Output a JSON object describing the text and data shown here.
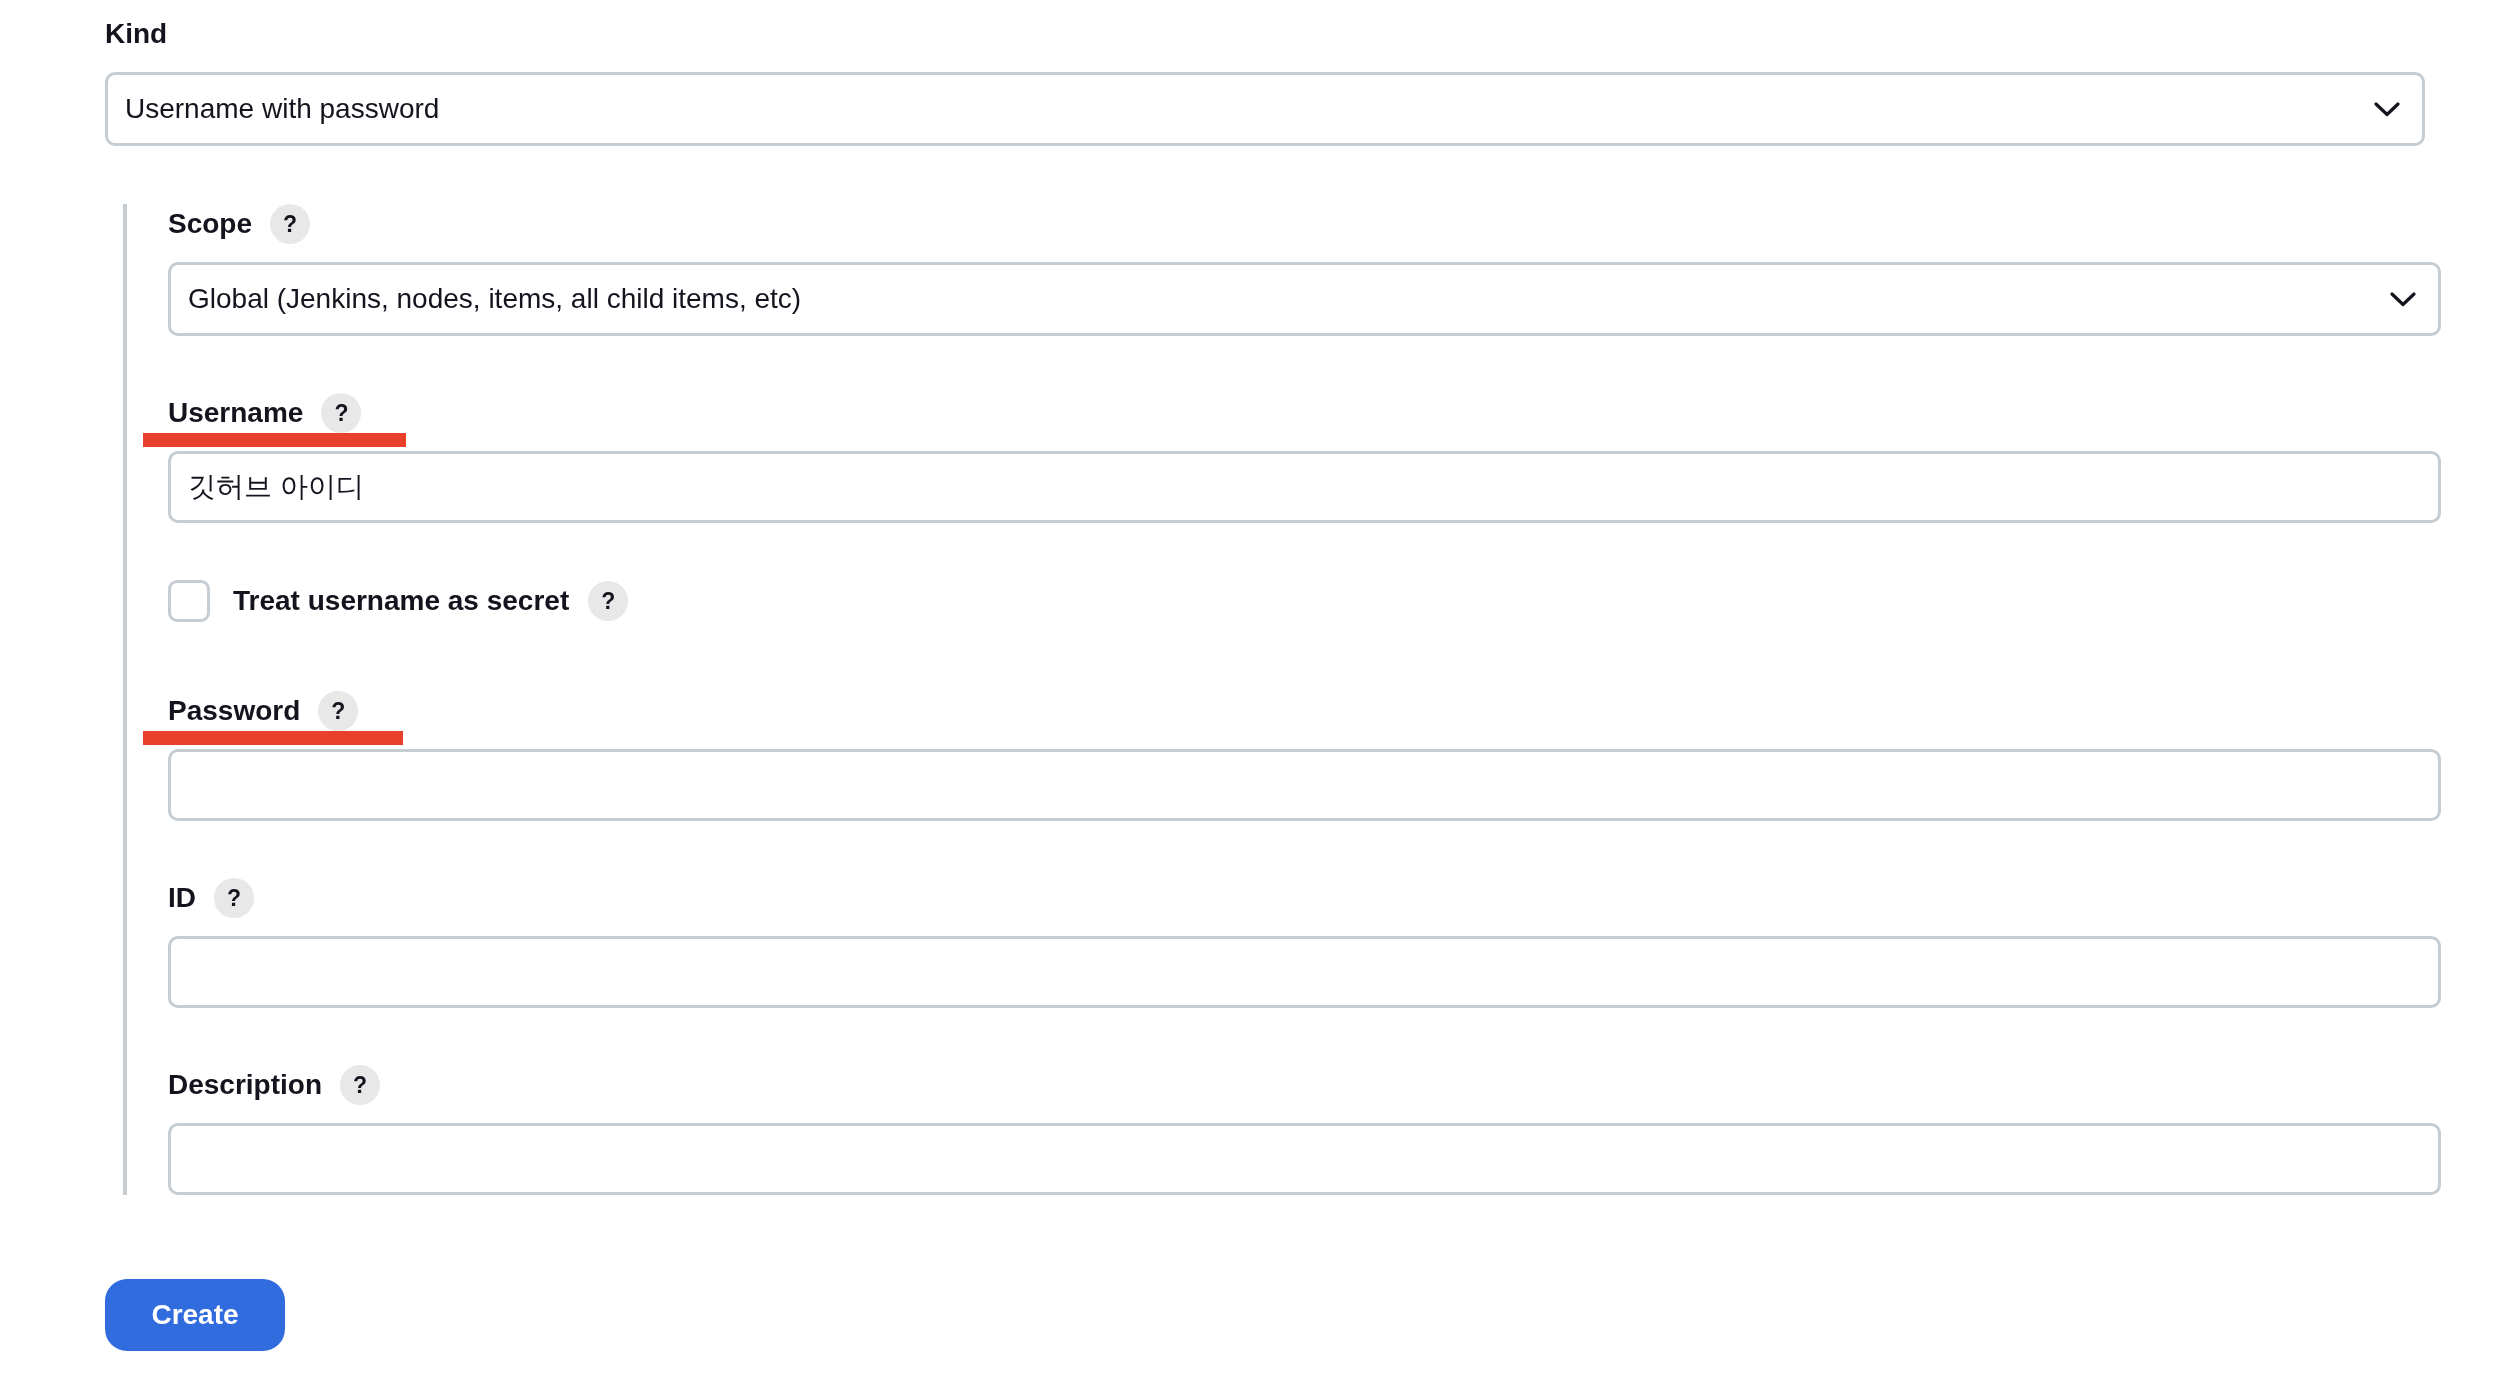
{
  "kind": {
    "label": "Kind",
    "value": "Username with password"
  },
  "fields": [
    {
      "kind": "select",
      "label": "Scope",
      "help": "?",
      "value": "Global (Jenkins, nodes, items, all child items, etc)",
      "highlighted": false
    },
    {
      "kind": "text",
      "label": "Username",
      "help": "?",
      "value": "깃허브 아이디",
      "highlighted": true
    },
    {
      "kind": "checkbox",
      "label": "Treat username as secret",
      "help": "?",
      "checked": false,
      "highlighted": false
    },
    {
      "kind": "password",
      "label": "Password",
      "help": "?",
      "highlighted": true
    },
    {
      "kind": "text",
      "label": "ID",
      "help": "?",
      "highlighted": false
    },
    {
      "kind": "text",
      "label": "Description",
      "help": "?",
      "highlighted": false
    }
  ],
  "button": {
    "label": "Create"
  }
}
